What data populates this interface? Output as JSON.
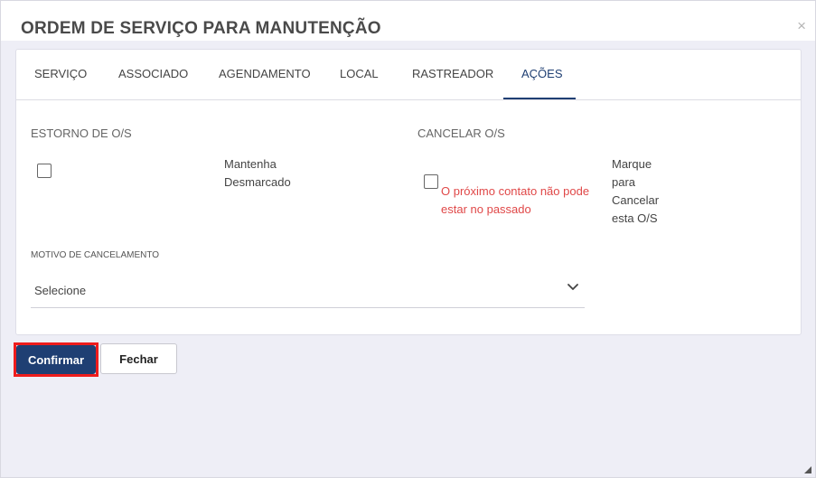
{
  "modal": {
    "title": "ORDEM DE SERVIÇO PARA MANUTENÇÃO",
    "close_label": "×"
  },
  "tabs": [
    {
      "label": "SERVIÇO",
      "active": false
    },
    {
      "label": "ASSOCIADO",
      "active": false
    },
    {
      "label": "AGENDAMENTO",
      "active": false
    },
    {
      "label": "LOCAL",
      "active": false
    },
    {
      "label": "RASTREADOR",
      "active": false
    },
    {
      "label": "AÇÕES",
      "active": true
    }
  ],
  "estorno": {
    "label": "ESTORNO DE O/S",
    "help_line1": "Mantenha",
    "help_line2": "Desmarcado",
    "checked": false
  },
  "cancelar": {
    "label": "CANCELAR O/S",
    "error_line1": "O próximo contato não pode",
    "error_line2": "estar no passado",
    "help_line1": "Marque",
    "help_line2": "para",
    "help_line3": "Cancelar",
    "help_line4": "esta O/S",
    "checked": false
  },
  "motivo": {
    "label": "MOTIVO DE CANCELAMENTO",
    "selected": "Selecione"
  },
  "buttons": {
    "confirm": "Confirmar",
    "close": "Fechar"
  },
  "colors": {
    "primary": "#1f3f73",
    "error": "#e04848",
    "highlight": "#ee1c1c"
  }
}
